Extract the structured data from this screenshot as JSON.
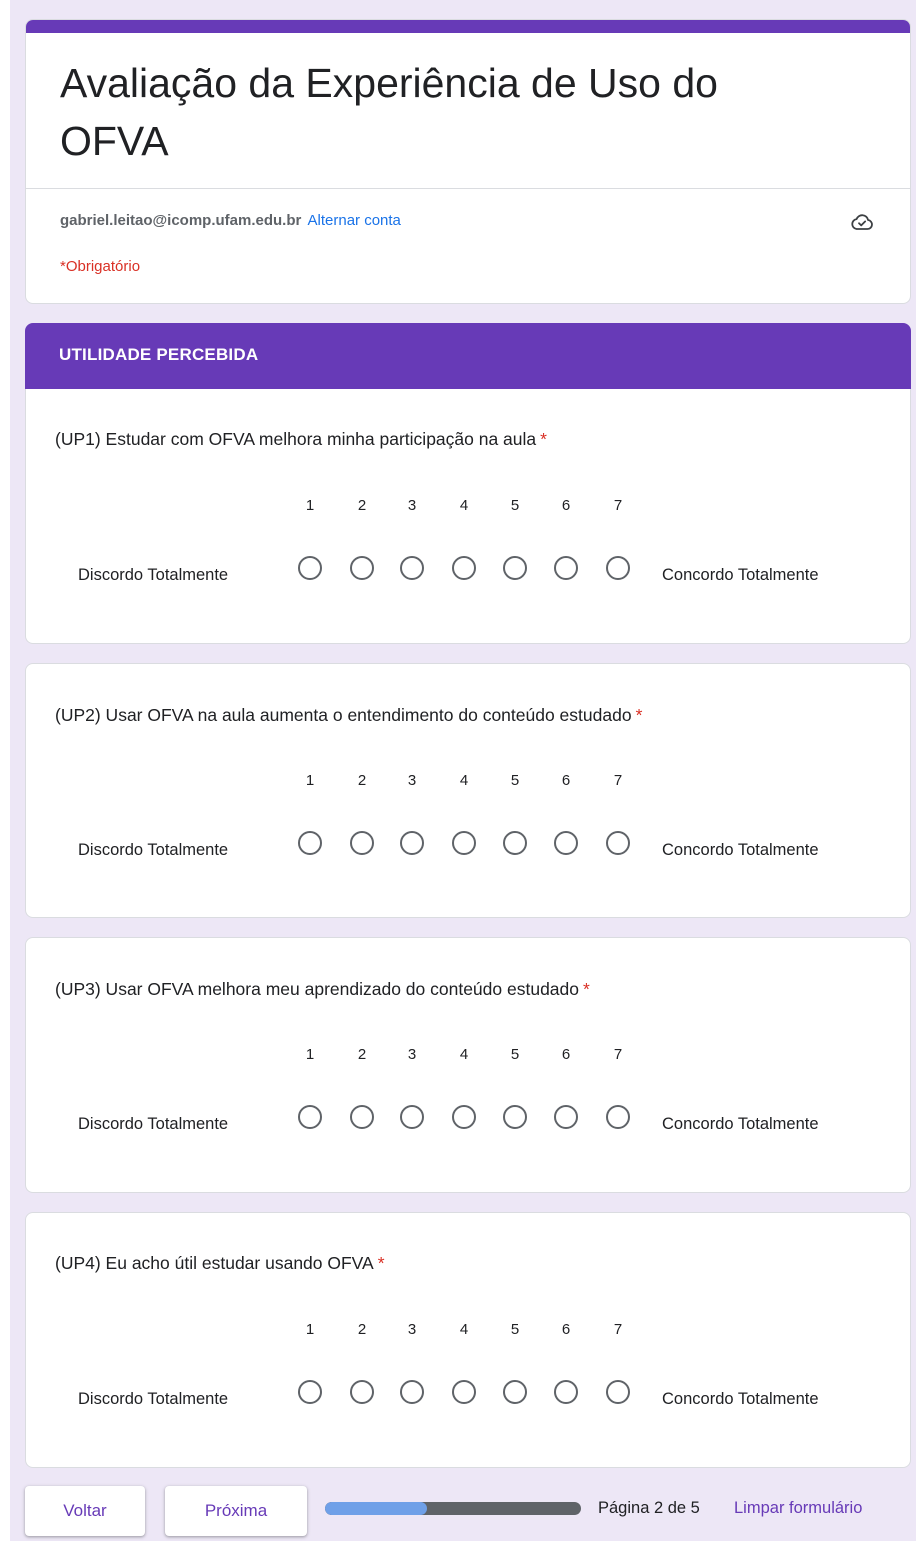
{
  "form": {
    "title": "Avaliação da Experiência de Uso do OFVA",
    "account_email": "gabriel.leitao@icomp.ufam.edu.br",
    "switch_account": "Alternar conta",
    "required_note": "*Obrigatório",
    "accent_color": "#673ab7"
  },
  "section": {
    "title": "UTILIDADE PERCEBIDA"
  },
  "questions": [
    {
      "title": "(UP1) Estudar com OFVA melhora minha participação na aula",
      "required_mark": "*",
      "scale": [
        "1",
        "2",
        "3",
        "4",
        "5",
        "6",
        "7"
      ],
      "left_label": "Discordo Totalmente",
      "right_label": "Concordo Totalmente"
    },
    {
      "title": "(UP2) Usar OFVA na aula aumenta o entendimento do conteúdo estudado",
      "required_mark": "*",
      "scale": [
        "1",
        "2",
        "3",
        "4",
        "5",
        "6",
        "7"
      ],
      "left_label": "Discordo Totalmente",
      "right_label": "Concordo Totalmente"
    },
    {
      "title": "(UP3) Usar OFVA melhora meu aprendizado do conteúdo estudado",
      "required_mark": "*",
      "scale": [
        "1",
        "2",
        "3",
        "4",
        "5",
        "6",
        "7"
      ],
      "left_label": "Discordo Totalmente",
      "right_label": "Concordo Totalmente"
    },
    {
      "title": "(UP4) Eu acho útil estudar usando OFVA",
      "required_mark": "*",
      "scale": [
        "1",
        "2",
        "3",
        "4",
        "5",
        "6",
        "7"
      ],
      "left_label": "Discordo Totalmente",
      "right_label": "Concordo Totalmente"
    }
  ],
  "footer": {
    "back_label": "Voltar",
    "next_label": "Próxima",
    "progress_fraction": 0.4,
    "page_indicator": "Página 2 de 5",
    "clear_form": "Limpar formulário"
  },
  "icons": {
    "cloud": "cloud-saved-icon"
  }
}
